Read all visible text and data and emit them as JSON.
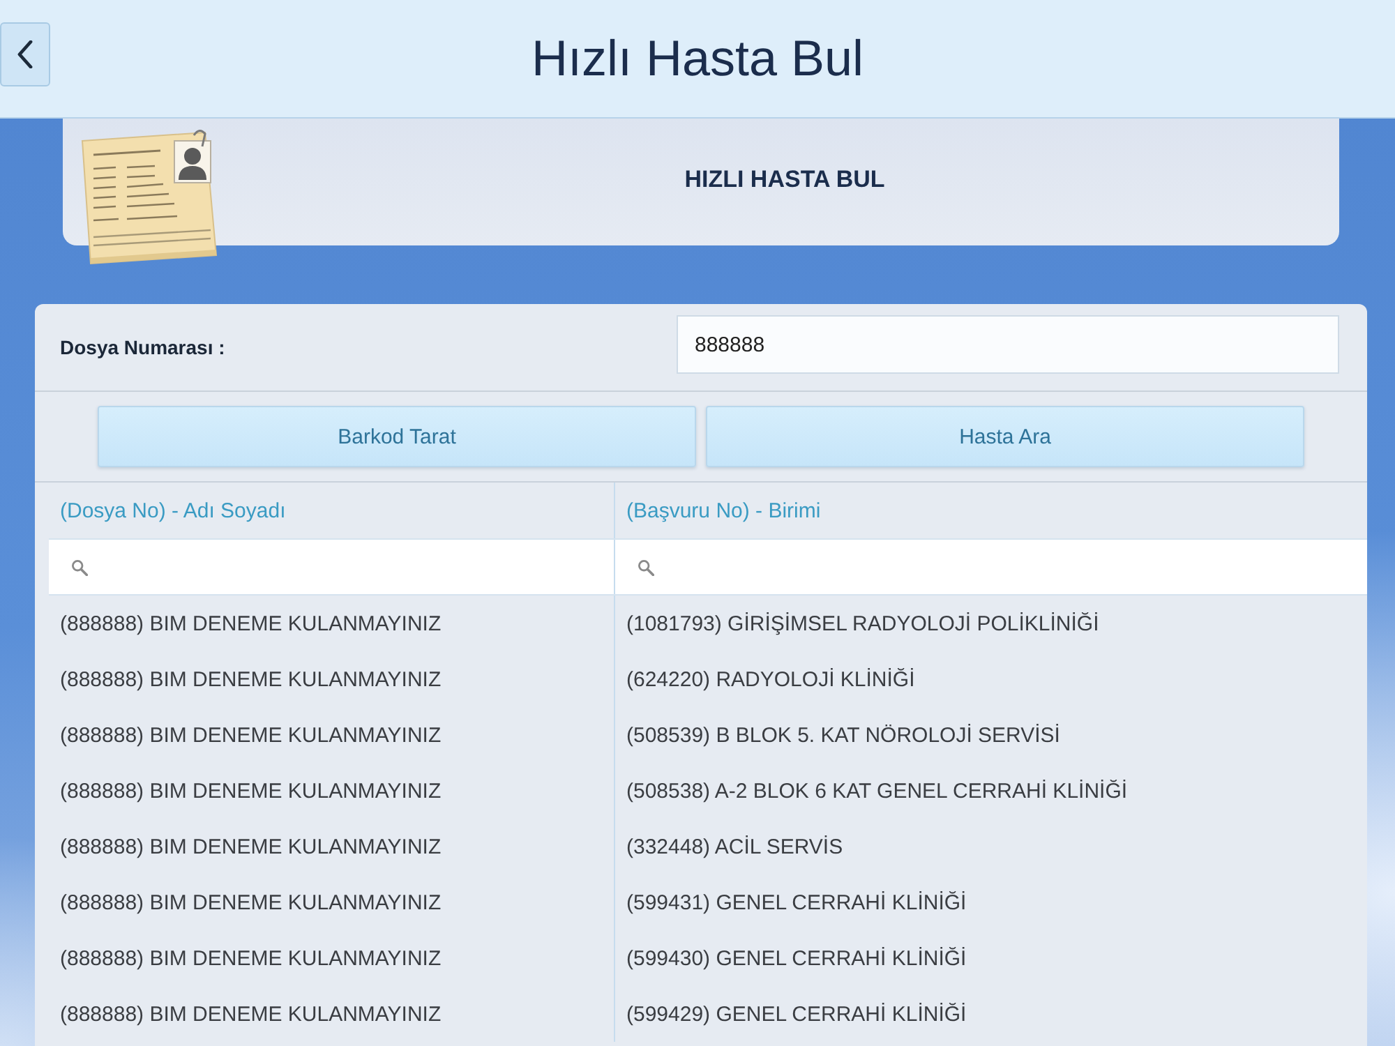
{
  "header": {
    "title": "Hızlı Hasta Bul"
  },
  "banner": {
    "title": "HIZLI HASTA BUL"
  },
  "form": {
    "label": "Dosya Numarası :",
    "value": "888888"
  },
  "buttons": [
    "Barkod Tarat",
    "Hasta Ara"
  ],
  "table": {
    "columns": [
      "(Dosya No) - Adı Soyadı",
      "(Başvuru No) - Birimi"
    ],
    "rows": [
      [
        "(888888) BIM DENEME KULANMAYINIZ",
        "(1081793) GİRİŞİMSEL RADYOLOJİ POLİKLİNİĞİ"
      ],
      [
        "(888888) BIM DENEME KULANMAYINIZ",
        "(624220) RADYOLOJİ KLİNİĞİ"
      ],
      [
        "(888888) BIM DENEME KULANMAYINIZ",
        "(508539) B BLOK 5. KAT NÖROLOJİ SERVİSİ"
      ],
      [
        "(888888) BIM DENEME KULANMAYINIZ",
        "(508538) A-2 BLOK 6 KAT GENEL CERRAHİ KLİNİĞİ"
      ],
      [
        "(888888) BIM DENEME KULANMAYINIZ",
        "(332448) ACİL SERVİS"
      ],
      [
        "(888888) BIM DENEME KULANMAYINIZ",
        "(599431) GENEL CERRAHİ KLİNİĞİ"
      ],
      [
        "(888888) BIM DENEME KULANMAYINIZ",
        "(599430) GENEL CERRAHİ KLİNİĞİ"
      ],
      [
        "(888888) BIM DENEME KULANMAYINIZ",
        "(599429) GENEL CERRAHİ KLİNİĞİ"
      ]
    ]
  }
}
